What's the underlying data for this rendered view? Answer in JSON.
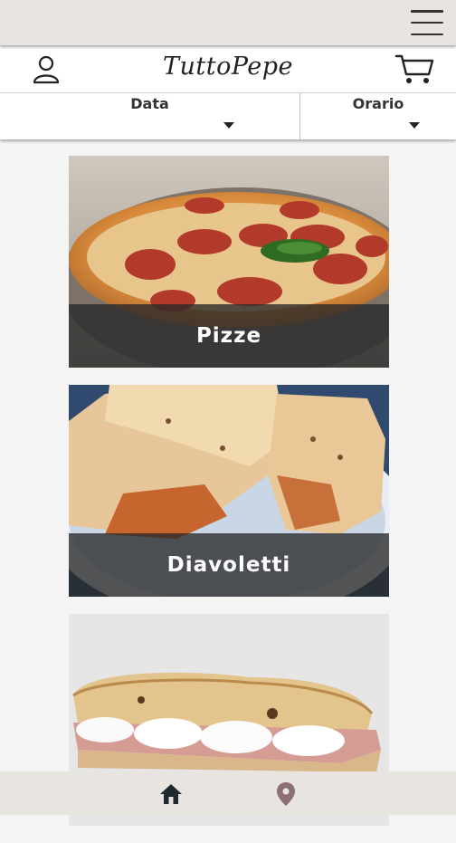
{
  "header": {
    "logo_text": "TuttoPepe",
    "user_icon": "user-icon",
    "cart_icon": "cart-icon",
    "menu_icon": "hamburger-menu-icon"
  },
  "filters": {
    "date_label": "Data",
    "time_label": "Orario"
  },
  "categories": [
    {
      "name": "Pizze"
    },
    {
      "name": "Diavoletti"
    },
    {
      "name": ""
    }
  ],
  "bottom_nav": {
    "items": [
      {
        "icon": "home-icon",
        "active": true,
        "color": "#1f2a2e"
      },
      {
        "icon": "location-pin-icon",
        "active": false,
        "color": "#8a6f73"
      }
    ]
  }
}
